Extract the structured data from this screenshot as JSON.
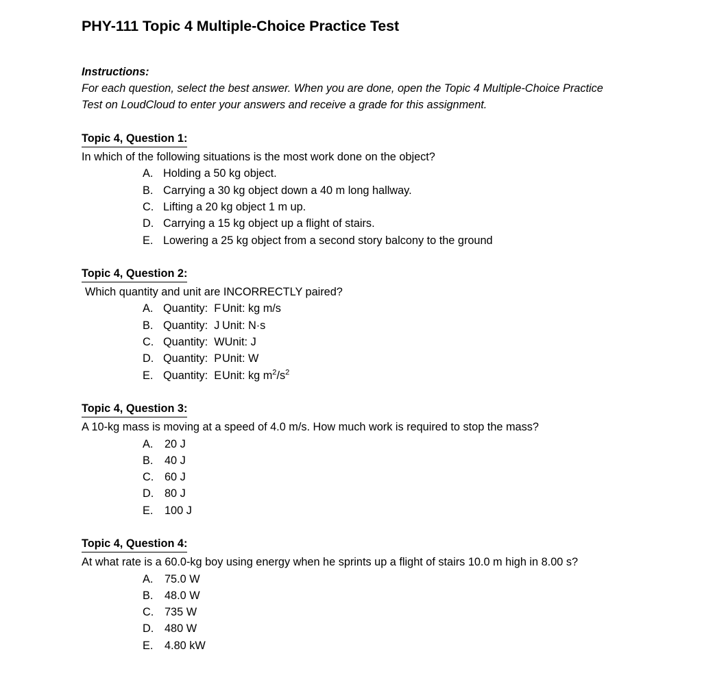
{
  "document": {
    "title": "PHY-111 Topic 4 Multiple-Choice Practice Test",
    "instructions": {
      "heading": "Instructions:",
      "body": "For each question, select the best answer. When you are done, open the Topic 4 Multiple-Choice Practice Test on LoudCloud to enter your answers and receive a grade for this assignment."
    },
    "questions": [
      {
        "heading": "Topic 4, Question 1:",
        "stem": "In which of the following situations is the most work done on the object?",
        "options": [
          {
            "letter": "A.",
            "text": "Holding a 50 kg object."
          },
          {
            "letter": "B.",
            "text": "Carrying a 30 kg object down a 40 m long hallway."
          },
          {
            "letter": "C.",
            "text": "Lifting a 20 kg object 1 m up."
          },
          {
            "letter": "D.",
            "text": "Carrying a 15 kg object up a flight of stairs."
          },
          {
            "letter": "E.",
            "text": "Lowering a 25 kg object from a second story balcony to the ground"
          }
        ]
      },
      {
        "heading": "Topic 4, Question 2:",
        "stem": "Which quantity and unit are INCORRECTLY paired?",
        "options": [
          {
            "letter": "A.",
            "quantity": "Quantity:  F",
            "unit": "Unit: kg m/s"
          },
          {
            "letter": "B.",
            "quantity": "Quantity:  J",
            "unit": "Unit: N·s"
          },
          {
            "letter": "C.",
            "quantity": "Quantity:  W",
            "unit": "Unit: J"
          },
          {
            "letter": "D.",
            "quantity": "Quantity:  P",
            "unit": "Unit: W"
          },
          {
            "letter": "E.",
            "quantity": "Quantity:  E",
            "unit": "Unit: kg m²/s²",
            "unit_html": true
          }
        ]
      },
      {
        "heading": "Topic 4, Question 3:",
        "stem": "A 10-kg mass is moving at a speed of 4.0 m/s. How much work is required to stop the mass?",
        "options": [
          {
            "letter": "A.",
            "text": "20 J"
          },
          {
            "letter": "B.",
            "text": "40 J"
          },
          {
            "letter": "C.",
            "text": "60 J"
          },
          {
            "letter": "D.",
            "text": "80 J"
          },
          {
            "letter": "E.",
            "text": "100 J"
          }
        ]
      },
      {
        "heading": "Topic 4, Question 4:",
        "stem": "At what rate is a 60.0-kg boy using energy when he sprints up a flight of stairs 10.0 m high in 8.00 s?",
        "options": [
          {
            "letter": "A.",
            "text": "75.0 W"
          },
          {
            "letter": "B.",
            "text": "48.0 W"
          },
          {
            "letter": "C.",
            "text": "735 W"
          },
          {
            "letter": "D.",
            "text": "480 W"
          },
          {
            "letter": "E.",
            "text": "4.80 kW"
          }
        ]
      }
    ]
  }
}
